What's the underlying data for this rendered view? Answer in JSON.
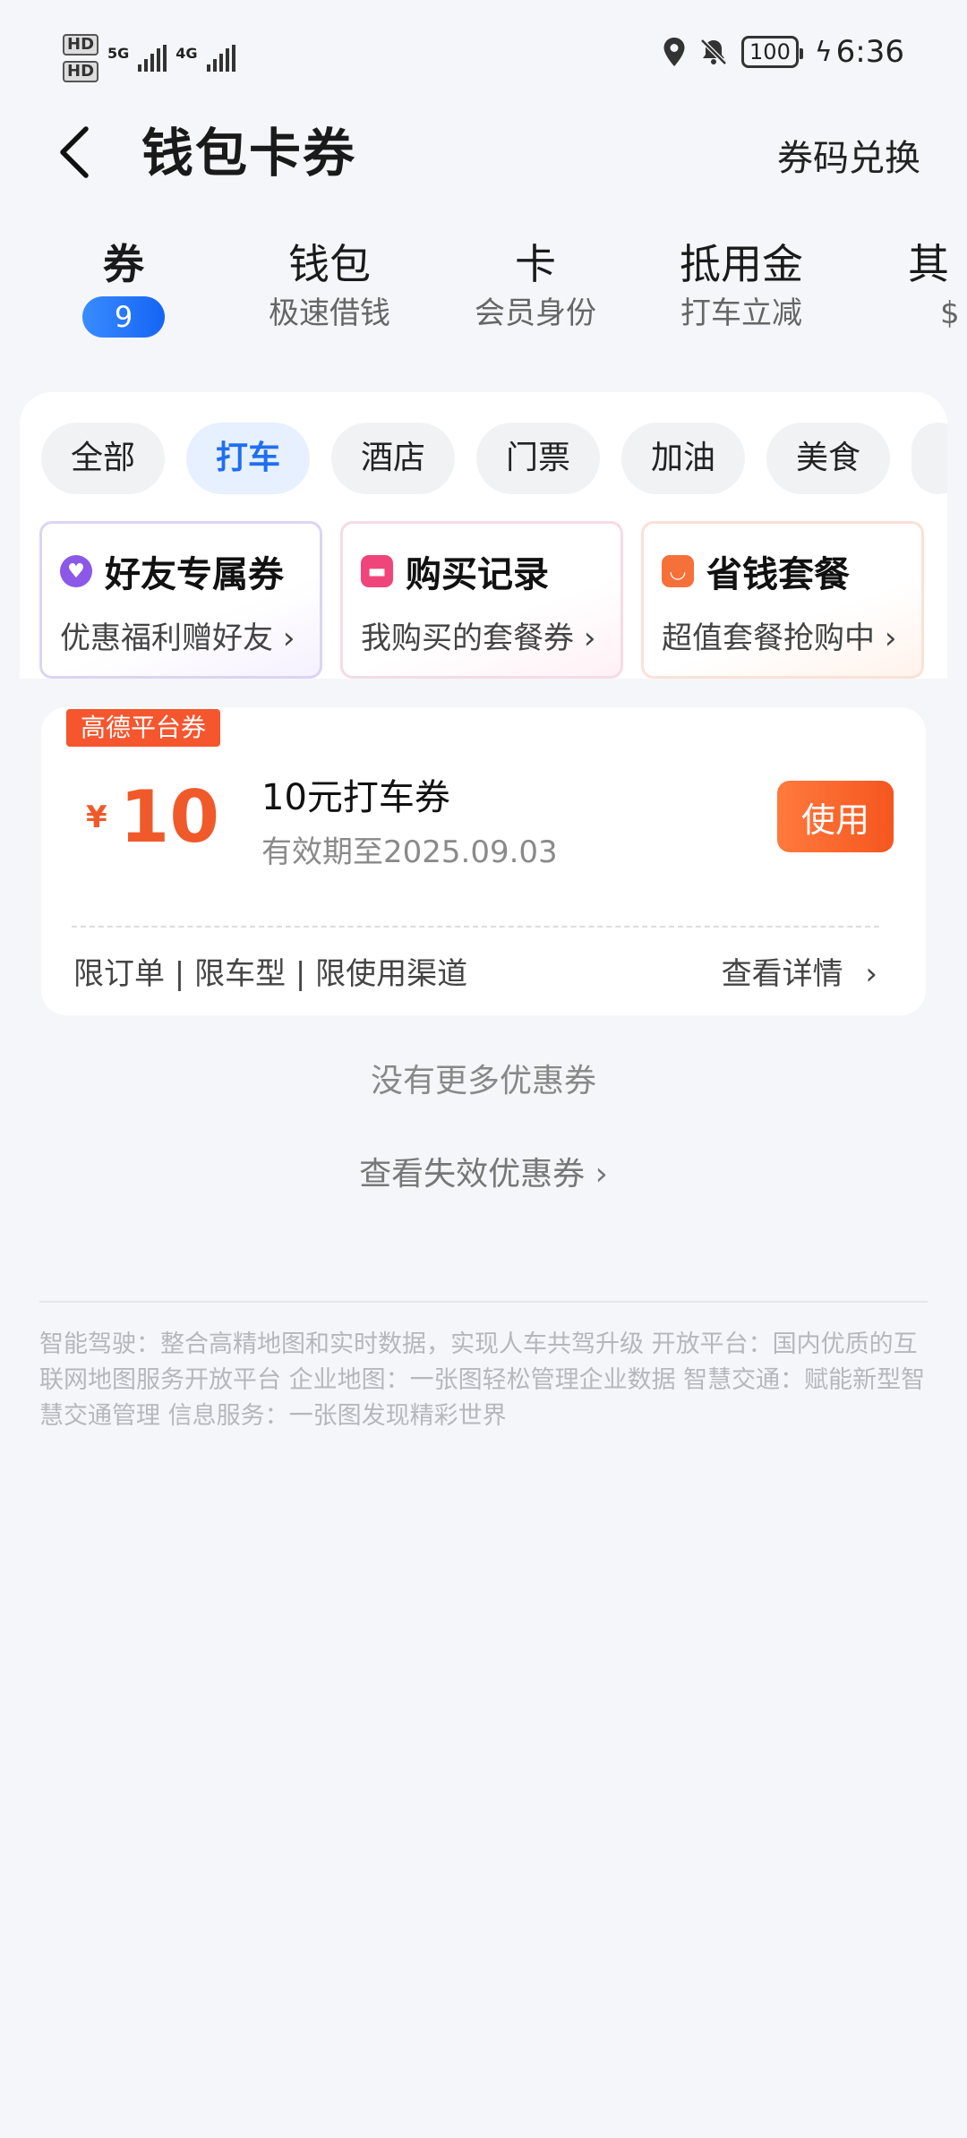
{
  "status_bar": {
    "hd1": "HD",
    "hd2": "HD",
    "net1": "5G",
    "net2": "4G",
    "battery": "100",
    "time": "6:36"
  },
  "header": {
    "title": "钱包卡券",
    "action": "券码兑换"
  },
  "tabs": [
    {
      "title": "券",
      "badge": "9"
    },
    {
      "title": "钱包",
      "subtitle": "极速借钱"
    },
    {
      "title": "卡",
      "subtitle": "会员身份"
    },
    {
      "title": "抵用金",
      "subtitle": "打车立减"
    },
    {
      "title": "其",
      "subtitle": "$"
    }
  ],
  "filters": [
    "全部",
    "打车",
    "酒店",
    "门票",
    "加油",
    "美食"
  ],
  "entries": [
    {
      "title": "好友专属券",
      "desc": "优惠福利赠好友"
    },
    {
      "title": "购买记录",
      "desc": "我购买的套餐券"
    },
    {
      "title": "省钱套餐",
      "desc": "超值套餐抢购中"
    }
  ],
  "coupon": {
    "tag": "高德平台券",
    "currency": "¥",
    "amount": "10",
    "name": "10元打车券",
    "expiry": "有效期至2025.09.03",
    "use_label": "使用",
    "restrictions": "限订单 | 限车型 | 限使用渠道",
    "detail_label": "查看详情"
  },
  "no_more": "没有更多优惠券",
  "expired_link": "查看失效优惠券",
  "footer_text": "智能驾驶：整合高精地图和实时数据，实现人车共驾升级 开放平台：国内优质的互联网地图服务开放平台 企业地图：一张图轻松管理企业数据 智慧交通：赋能新型智慧交通管理 信息服务：一张图发现精彩世界",
  "colors": {
    "accent_blue": "#1f6ff2",
    "accent_orange": "#f5562e",
    "background": "#f5f6f9"
  }
}
